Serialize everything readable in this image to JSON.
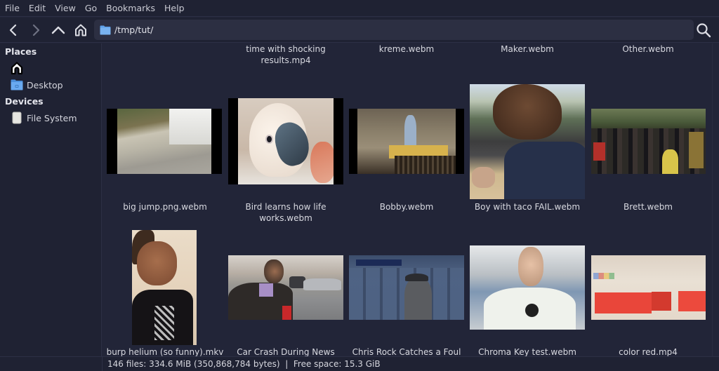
{
  "menubar": {
    "items": [
      "File",
      "Edit",
      "View",
      "Go",
      "Bookmarks",
      "Help"
    ]
  },
  "toolbar": {
    "back_icon": "chevron-left-icon",
    "forward_icon": "chevron-right-icon",
    "up_icon": "chevron-up-icon",
    "home_icon": "home-icon",
    "location_path": "/tmp/tut/",
    "location_icon": "folder-icon",
    "search_icon": "search-icon"
  },
  "sidebar": {
    "sections": [
      {
        "header": "Places",
        "items": [
          {
            "label": "",
            "icon": "home-icon"
          },
          {
            "label": "Desktop",
            "icon": "folder-icon"
          }
        ]
      },
      {
        "header": "Devices",
        "items": [
          {
            "label": "File System",
            "icon": "drive-icon"
          }
        ]
      }
    ]
  },
  "files": {
    "row0": [
      {
        "name": "",
        "lines": [
          "",
          ""
        ]
      },
      {
        "name": "time with shocking results.mp4",
        "lines": [
          "time with shocking",
          "results.mp4"
        ]
      },
      {
        "name": "kreme.webm",
        "lines": [
          "kreme.webm",
          ""
        ]
      },
      {
        "name": "Maker.webm",
        "lines": [
          "Maker.webm",
          ""
        ]
      },
      {
        "name": "Other.webm",
        "lines": [
          "Other.webm",
          ""
        ]
      }
    ],
    "row1": [
      {
        "name": "big jump.png.webm",
        "lines": [
          "big jump.png.webm",
          ""
        ]
      },
      {
        "name": "Bird learns how life works.webm",
        "lines": [
          "Bird learns how life",
          "works.webm"
        ]
      },
      {
        "name": "Bobby.webm",
        "lines": [
          "Bobby.webm",
          ""
        ]
      },
      {
        "name": "Boy with taco FAIL.webm",
        "lines": [
          "Boy with taco FAIL.webm",
          ""
        ]
      },
      {
        "name": "Brett.webm",
        "lines": [
          "Brett.webm",
          ""
        ]
      }
    ],
    "row2": [
      {
        "name": "burp helium (so funny).mkv",
        "lines": [
          "burp helium (so funny).mkv",
          ""
        ]
      },
      {
        "name": "Car Crash During News",
        "lines": [
          "Car Crash During News",
          ""
        ]
      },
      {
        "name": "Chris Rock Catches a Foul",
        "lines": [
          "Chris Rock Catches a Foul",
          ""
        ]
      },
      {
        "name": "Chroma Key test.webm",
        "lines": [
          "Chroma Key test.webm",
          ""
        ]
      },
      {
        "name": "color red.mp4",
        "lines": [
          "color red.mp4",
          ""
        ]
      }
    ]
  },
  "statusbar": {
    "text": "146 files: 334.6 MiB (350,868,784 bytes)  |  Free space: 15.3 GiB"
  },
  "colors": {
    "background": "#222538",
    "chrome": "#1f2233",
    "location_bg": "#2c2f42",
    "folder_blue": "#5ea0e8",
    "text": "#d8d9e0"
  }
}
